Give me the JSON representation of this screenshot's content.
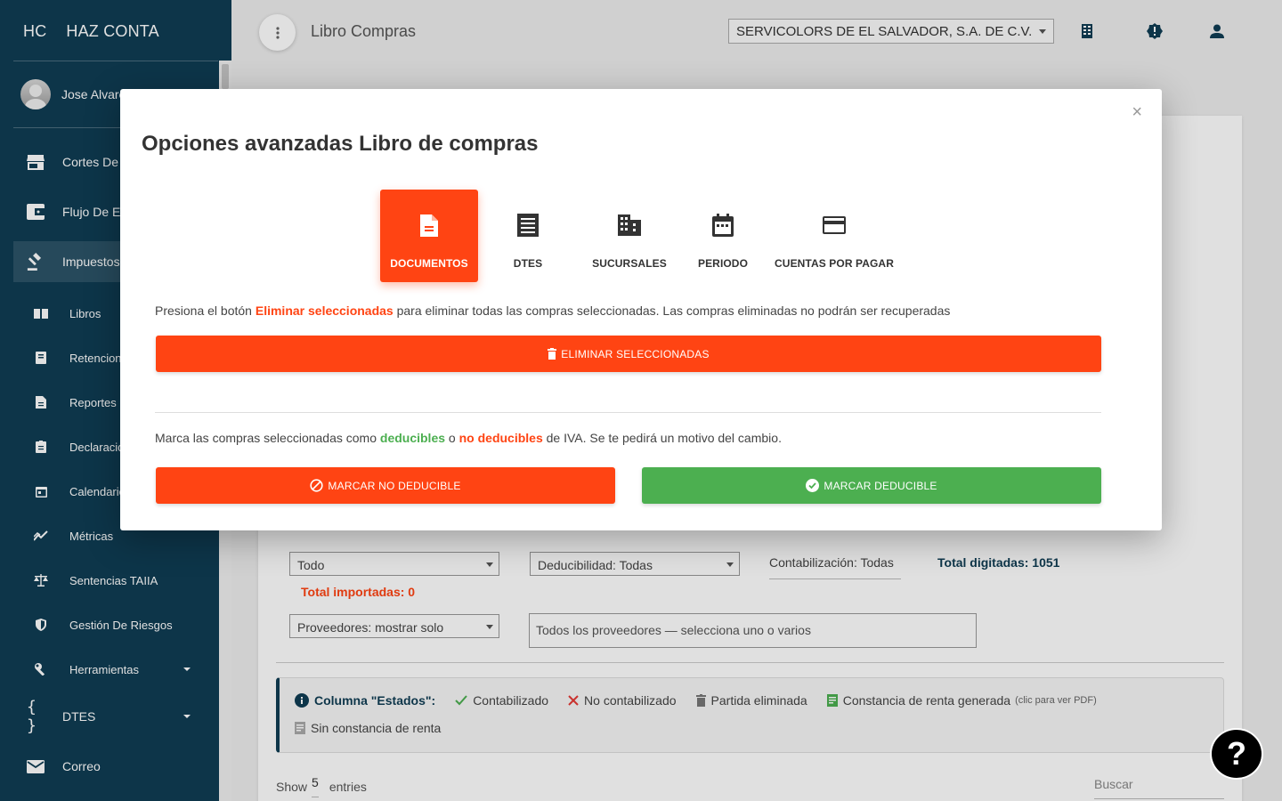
{
  "sidebar": {
    "brand_mini": "HC",
    "brand_full": "HAZ CONTA",
    "user_name": "Jose Alvarez",
    "items": [
      {
        "label": "Cortes De Caja",
        "icon": "store-icon"
      },
      {
        "label": "Flujo De Efectivo",
        "icon": "wallet-icon"
      },
      {
        "label": "Impuestos",
        "icon": "gavel-icon"
      }
    ],
    "subitems": [
      {
        "label": "Libros",
        "icon": "book-icon"
      },
      {
        "label": "Retenciones",
        "icon": "receipt-icon"
      },
      {
        "label": "Reportes",
        "icon": "document-icon"
      },
      {
        "label": "Declaraciones",
        "icon": "clipboard-icon"
      },
      {
        "label": "Calendario",
        "icon": "calendar-icon"
      },
      {
        "label": "Métricas",
        "icon": "chart-line-icon"
      },
      {
        "label": "Sentencias TAIIA",
        "icon": "scale-icon"
      },
      {
        "label": "Gestión De Riesgos",
        "icon": "shield-icon"
      },
      {
        "label": "Herramientas",
        "icon": "wrench-icon"
      }
    ],
    "bottom_items": [
      {
        "label": "DTES",
        "icon": "braces-icon"
      },
      {
        "label": "Correo",
        "icon": "mail-icon"
      }
    ]
  },
  "header": {
    "page_title": "Libro Compras",
    "company": "SERVICOLORS DE EL SALVADOR, S.A. DE C.V."
  },
  "background": {
    "filter_todo": "Todo",
    "filter_deducibilidad": "Deducibilidad: Todas",
    "contabilizacion": "Contabilización: Todas",
    "total_digitadas": "Total digitadas: 1051",
    "total_importadas": "Total importadas: 0",
    "proveedores_select": "Proveedores: mostrar solo",
    "proveedores_placeholder": "Todos los proveedores — selecciona uno o varios",
    "legend_title": "Columna \"Estados\":",
    "legend_items": {
      "contabilizado": "Contabilizado",
      "no_contabilizado": "No contabilizado",
      "partida_eliminada": "Partida eliminada",
      "constancia_generada": "Constancia de renta generada",
      "constancia_hint": "(clic para ver PDF)",
      "sin_constancia": "Sin constancia de renta"
    },
    "show_label": "Show",
    "show_value": "5",
    "entries_label": "entries",
    "search_label": "Buscar"
  },
  "modal": {
    "close": "×",
    "title": "Opciones avanzadas Libro de compras",
    "tabs": [
      {
        "label": "DOCUMENTOS",
        "icon": "document-icon",
        "active": true
      },
      {
        "label": "DTES",
        "icon": "list-document-icon",
        "active": false
      },
      {
        "label": "SUCURSALES",
        "icon": "building-icon",
        "active": false
      },
      {
        "label": "PERIODO",
        "icon": "calendar-icon",
        "active": false
      },
      {
        "label": "CUENTAS POR PAGAR",
        "icon": "credit-card-icon",
        "active": false
      }
    ],
    "delete_text_pre": "Presiona el botón ",
    "delete_text_highlight": "Eliminar seleccionadas",
    "delete_text_post": " para eliminar todas las compras seleccionadas. Las compras eliminadas no podrán ser recuperadas",
    "delete_button": "ELIMINAR SELECCIONADAS",
    "mark_text_pre": "Marca las compras seleccionadas como ",
    "mark_text_deducibles": "deducibles",
    "mark_text_mid": " o ",
    "mark_text_no_deducibles": "no deducibles",
    "mark_text_post": " de IVA. Se te pedirá un motivo del cambio.",
    "no_deducible_button": "MARCAR NO DEDUCIBLE",
    "deducible_button": "MARCAR DEDUCIBLE"
  },
  "help": "?",
  "colors": {
    "sidebar_bg": "#0f3d54",
    "accent_orange": "#ff4413",
    "accent_green": "#4caf50"
  }
}
